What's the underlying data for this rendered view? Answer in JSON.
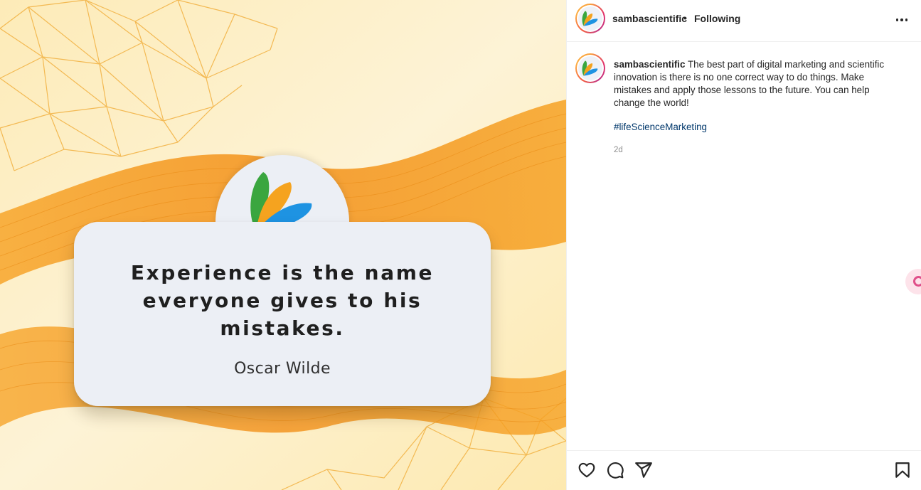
{
  "post_image": {
    "quote_lines": "Experience is the name\neveryone gives to his\nmistakes.",
    "author": "Oscar Wilde",
    "logo_icon": "samba-scientific-petal-logo",
    "colors": {
      "background": "#fdf1cf",
      "wave": "#f59a1c",
      "card": "#eceff5",
      "petal_green": "#3aa63f",
      "petal_orange": "#f5a31f",
      "petal_blue": "#1e93e2"
    }
  },
  "header": {
    "username": "sambascientific",
    "separator": "•",
    "follow_status": "Following",
    "more_icon": "more-horizontal-icon"
  },
  "caption": {
    "username": "sambascientific",
    "text": "The best part of digital marketing and scientific innovation is there is no one correct way to do things. Make mistakes and apply those lessons to the future. You can help change the world!",
    "hashtag": "#lifeScienceMarketing",
    "time": "2d"
  },
  "actions": {
    "like_icon": "heart-icon",
    "comment_icon": "comment-icon",
    "share_icon": "paper-plane-icon",
    "save_icon": "bookmark-icon"
  }
}
